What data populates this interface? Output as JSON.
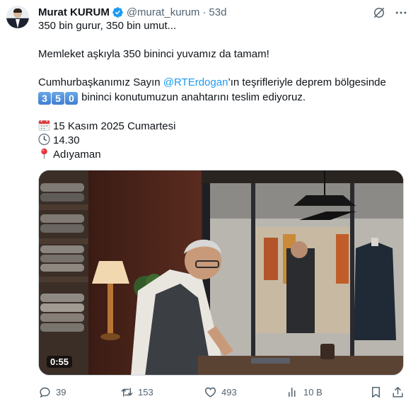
{
  "author": {
    "name": "Murat KURUM",
    "handle": "@murat_kurum",
    "separator": "·",
    "time": "53d"
  },
  "tweet": {
    "line1": "350 bin gurur, 350 bin umut...",
    "line2": "Memleket aşkıyla 350 bininci yuvamız da tamam!",
    "line3_pre": "Cumhurbaşkanımız Sayın ",
    "line3_mention": "@RTErdogan",
    "line3_post": "’ın teşrifleriyle deprem bölgesinde",
    "keycaps": [
      "3",
      "5",
      "0"
    ],
    "line4_post": " bininci konutumuzun anahtarını teslim ediyoruz.",
    "date": "15 Kasım 2025 Cumartesi",
    "clock": "14.30",
    "place": "Adıyaman"
  },
  "media": {
    "duration": "0:55"
  },
  "actions": {
    "replies": "39",
    "reposts": "153",
    "likes": "493",
    "views": "10 B"
  },
  "colors": {
    "accent": "#1d9bf0",
    "secondary_text": "#536471",
    "verified": "#1d9bf0"
  }
}
